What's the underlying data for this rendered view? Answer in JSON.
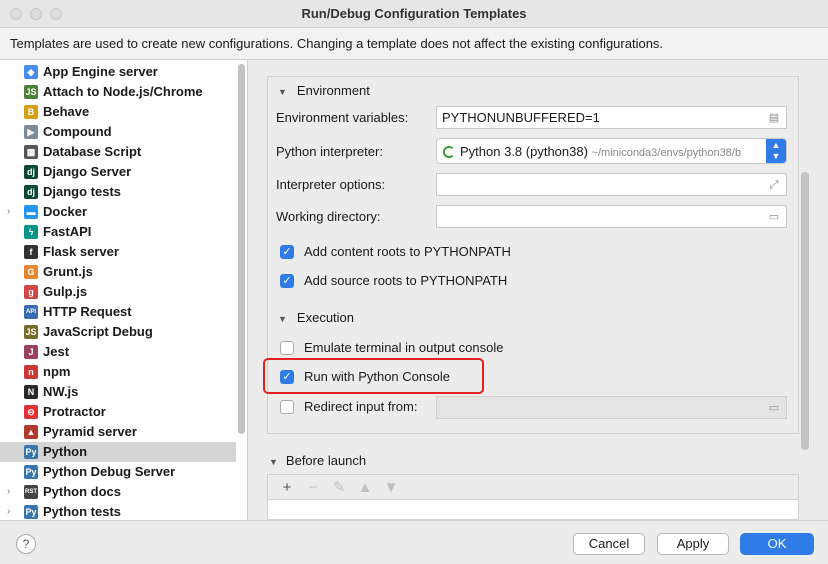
{
  "window": {
    "title": "Run/Debug Configuration Templates"
  },
  "info": {
    "text": "Templates are used to create new configurations. Changing a template does not affect the existing configurations."
  },
  "templates": [
    {
      "label": "App Engine server",
      "icon": "app-engine-icon",
      "color": "#4a8df0",
      "glyph": "◆",
      "expandable": false
    },
    {
      "label": "Attach to Node.js/Chrome",
      "icon": "nodejs-icon",
      "color": "#4e7f3a",
      "glyph": "JS",
      "expandable": false
    },
    {
      "label": "Behave",
      "icon": "behave-icon",
      "color": "#d4a017",
      "glyph": "B",
      "expandable": false
    },
    {
      "label": "Compound",
      "icon": "compound-icon",
      "color": "#7a8c99",
      "glyph": "▶",
      "expandable": false
    },
    {
      "label": "Database Script",
      "icon": "database-icon",
      "color": "#555555",
      "glyph": "▦",
      "expandable": false
    },
    {
      "label": "Django Server",
      "icon": "django-icon",
      "color": "#0c4b33",
      "glyph": "dj",
      "expandable": false
    },
    {
      "label": "Django tests",
      "icon": "django-tests-icon",
      "color": "#0c4b33",
      "glyph": "dj",
      "expandable": false
    },
    {
      "label": "Docker",
      "icon": "docker-icon",
      "color": "#2496ed",
      "glyph": "▬",
      "expandable": true
    },
    {
      "label": "FastAPI",
      "icon": "fastapi-icon",
      "color": "#059486",
      "glyph": "ϟ",
      "expandable": false
    },
    {
      "label": "Flask server",
      "icon": "flask-icon",
      "color": "#333333",
      "glyph": "f",
      "expandable": false
    },
    {
      "label": "Grunt.js",
      "icon": "grunt-icon",
      "color": "#e48632",
      "glyph": "G",
      "expandable": false
    },
    {
      "label": "Gulp.js",
      "icon": "gulp-icon",
      "color": "#cf4647",
      "glyph": "g",
      "expandable": false
    },
    {
      "label": "HTTP Request",
      "icon": "http-api-icon",
      "color": "#3a6bb0",
      "glyph": "API",
      "expandable": false
    },
    {
      "label": "JavaScript Debug",
      "icon": "js-debug-icon",
      "color": "#7a6a2a",
      "glyph": "JS",
      "expandable": false
    },
    {
      "label": "Jest",
      "icon": "jest-icon",
      "color": "#99425b",
      "glyph": "J",
      "expandable": false
    },
    {
      "label": "npm",
      "icon": "npm-icon",
      "color": "#cb3837",
      "glyph": "n",
      "expandable": false
    },
    {
      "label": "NW.js",
      "icon": "nwjs-icon",
      "color": "#2a2a2a",
      "glyph": "N",
      "expandable": false
    },
    {
      "label": "Protractor",
      "icon": "protractor-icon",
      "color": "#e23237",
      "glyph": "⊖",
      "expandable": false
    },
    {
      "label": "Pyramid server",
      "icon": "pyramid-icon",
      "color": "#b03a2e",
      "glyph": "▲",
      "expandable": false
    },
    {
      "label": "Python",
      "icon": "python-icon",
      "color": "#3776ab",
      "glyph": "Py",
      "expandable": false,
      "selected": true
    },
    {
      "label": "Python Debug Server",
      "icon": "python-debug-icon",
      "color": "#3776ab",
      "glyph": "Py",
      "expandable": false
    },
    {
      "label": "Python docs",
      "icon": "rst-icon",
      "color": "#444444",
      "glyph": "RST",
      "expandable": true
    },
    {
      "label": "Python tests",
      "icon": "python-tests-icon",
      "color": "#3776ab",
      "glyph": "Py",
      "expandable": true
    }
  ],
  "environment": {
    "section_label": "Environment",
    "env_vars_label": "Environment variables:",
    "env_vars_value": "PYTHONUNBUFFERED=1",
    "interpreter_label": "Python interpreter:",
    "interpreter_value": "Python 3.8 (python38)",
    "interpreter_path": "~/miniconda3/envs/python38/b",
    "options_label": "Interpreter options:",
    "options_value": "",
    "workdir_label": "Working directory:",
    "workdir_value": "",
    "content_roots_label": "Add content roots to PYTHONPATH",
    "content_roots_checked": true,
    "source_roots_label": "Add source roots to PYTHONPATH",
    "source_roots_checked": true
  },
  "execution": {
    "section_label": "Execution",
    "emulate_label": "Emulate terminal in output console",
    "emulate_checked": false,
    "console_label": "Run with Python Console",
    "console_checked": true,
    "redirect_label": "Redirect input from:",
    "redirect_checked": false,
    "redirect_value": ""
  },
  "before_launch": {
    "section_label": "Before launch"
  },
  "footer": {
    "cancel_label": "Cancel",
    "apply_label": "Apply",
    "ok_label": "OK",
    "help_label": "?"
  },
  "colors": {
    "accent": "#2f7ce6",
    "highlight": "#e0231f",
    "close": "#dcdcdc"
  }
}
